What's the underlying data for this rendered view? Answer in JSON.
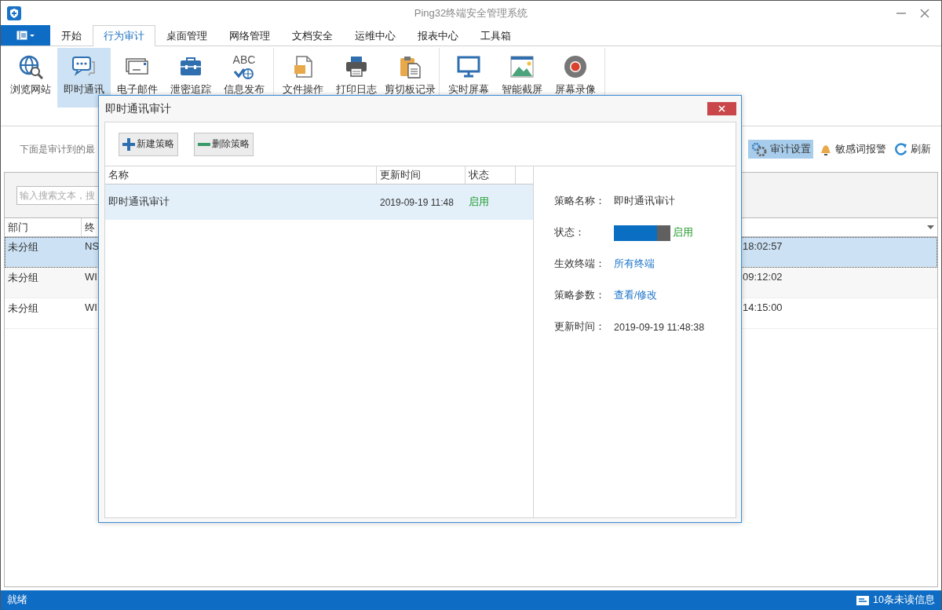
{
  "window": {
    "title": "Ping32终端安全管理系统"
  },
  "menu_tabs": [
    {
      "label": "开始",
      "selected": false
    },
    {
      "label": "行为审计",
      "selected": true
    },
    {
      "label": "桌面管理",
      "selected": false
    },
    {
      "label": "网络管理",
      "selected": false
    },
    {
      "label": "文档安全",
      "selected": false
    },
    {
      "label": "运维中心",
      "selected": false
    },
    {
      "label": "报表中心",
      "selected": false
    },
    {
      "label": "工具箱",
      "selected": false
    }
  ],
  "ribbon_groups": [
    {
      "items": [
        {
          "label": "浏览网站",
          "selected": false
        },
        {
          "label": "即时通讯",
          "selected": true
        },
        {
          "label": "电子邮件",
          "selected": false
        },
        {
          "label": "泄密追踪",
          "selected": false
        },
        {
          "label": "信息发布",
          "selected": false,
          "icon_text": "ABC"
        }
      ]
    },
    {
      "items": [
        {
          "label": "文件操作",
          "selected": false
        },
        {
          "label": "打印日志",
          "selected": false
        },
        {
          "label": "剪切板记录",
          "selected": false
        }
      ]
    },
    {
      "items": [
        {
          "label": "实时屏幕",
          "selected": false
        },
        {
          "label": "智能截屏",
          "selected": false
        },
        {
          "label": "屏幕录像",
          "selected": false
        }
      ]
    }
  ],
  "note": "下面是审计到的最",
  "toolbar": [
    {
      "label": "审计设置",
      "selected": true
    },
    {
      "label": "敏感词报警",
      "selected": false
    },
    {
      "label": "刷新",
      "selected": false
    }
  ],
  "search": {
    "placeholder": "输入搜索文本，搜"
  },
  "table": {
    "columns": [
      "部门",
      "终"
    ],
    "rows": [
      {
        "cells": [
          "未分组",
          "NS",
          "18:02:57"
        ],
        "selected": true
      },
      {
        "cells": [
          "未分组",
          "WI",
          "09:12:02"
        ],
        "selected": false
      },
      {
        "cells": [
          "未分组",
          "WI",
          "14:15:00"
        ],
        "selected": false
      }
    ]
  },
  "dialog": {
    "title": "即时通讯审计",
    "buttons": [
      {
        "label": "新建策略",
        "kind": "add"
      },
      {
        "label": "删除策略",
        "kind": "remove"
      }
    ],
    "list": {
      "columns": [
        "名称",
        "更新时间",
        "状态"
      ],
      "rows": [
        {
          "name": "即时通讯审计",
          "time": "2019-09-19 11:48",
          "status": "启用",
          "enabled": true,
          "selected": true
        }
      ]
    },
    "details": [
      {
        "label": "策略名称：",
        "value": "即时通讯审计",
        "kind": "text"
      },
      {
        "label": "状态：",
        "value": "启用",
        "kind": "toggle",
        "on": true
      },
      {
        "label": "生效终端：",
        "value": "所有终端",
        "kind": "link"
      },
      {
        "label": "策略参数：",
        "value": "查看/修改",
        "kind": "link"
      },
      {
        "label": "更新时间：",
        "value": "2019-09-19 11:48:38",
        "kind": "text"
      }
    ]
  },
  "status_bar": {
    "left": "就绪",
    "messages": "10条未读信息"
  }
}
